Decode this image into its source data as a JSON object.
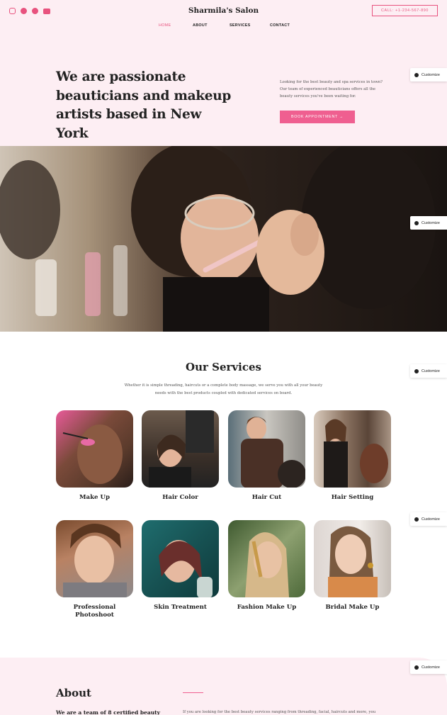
{
  "header": {
    "brand": "Sharmila's Salon",
    "call": "CALL: +1-234-567-890",
    "socials": [
      "instagram-icon",
      "facebook-icon",
      "pinterest-icon",
      "youtube-icon"
    ],
    "nav": [
      "HOME",
      "ABOUT",
      "SERVICES",
      "CONTACT"
    ]
  },
  "hero": {
    "title": "We are passionate beauticians and makeup artists based in New York",
    "text": "Looking for the best beauty and spa services in town? Our team of experienced beauticians offers all the beauty services you've been waiting for.",
    "button": "BOOK APPOINTMENT  →"
  },
  "customize_label": "Customize",
  "services": {
    "title": "Our Services",
    "description": "Whether it is simple threading, haircuts or a complete body massage, we serve you with all your beauty needs with the best products coupled with dedicated services on board.",
    "items": [
      {
        "name": "Make Up"
      },
      {
        "name": "Hair Color"
      },
      {
        "name": "Hair Cut"
      },
      {
        "name": "Hair Setting"
      },
      {
        "name": "Professional Photoshoot"
      },
      {
        "name": "Skin Treatment"
      },
      {
        "name": "Fashion Make Up"
      },
      {
        "name": "Bridal Make Up"
      }
    ]
  },
  "about": {
    "title": "About",
    "subtitle": "We are a team of 8 certified beauty",
    "text": "If you are looking for the best beauty services ranging from threading, facial, haircuts and more, you"
  },
  "colors": {
    "accent": "#ef5f90",
    "pink_bg": "#fdeef3"
  }
}
